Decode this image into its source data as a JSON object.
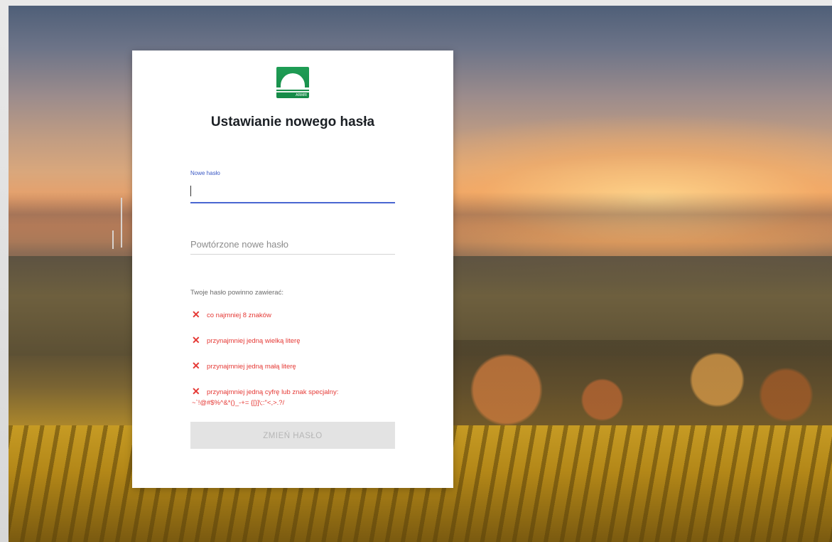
{
  "logo": {
    "text": "ARiMR"
  },
  "title": "Ustawianie nowego hasła",
  "new_password": {
    "label": "Nowe hasło",
    "value": ""
  },
  "repeat_password": {
    "placeholder": "Powtórzone nowe hasło",
    "value": ""
  },
  "requirements": {
    "heading": "Twoje hasło powinno zawierać:",
    "items": [
      {
        "icon": "x-icon",
        "text": "co najmniej 8 znaków"
      },
      {
        "icon": "x-icon",
        "text": "przynajmniej jedną wielką literę"
      },
      {
        "icon": "x-icon",
        "text": "przynajmniej jedną małą literę"
      },
      {
        "icon": "x-icon",
        "text": "przynajmniej jedną cyfrę lub znak specjalny:",
        "text2": "~`!@#$%^&*()_-+= {[}]\\;:\"<,>.?/"
      }
    ],
    "status_color": "#e53935"
  },
  "submit": {
    "label": "ZMIEŃ HASŁO",
    "disabled": true
  },
  "colors": {
    "accent": "#4a66d1",
    "brand": "#1f9d55"
  }
}
